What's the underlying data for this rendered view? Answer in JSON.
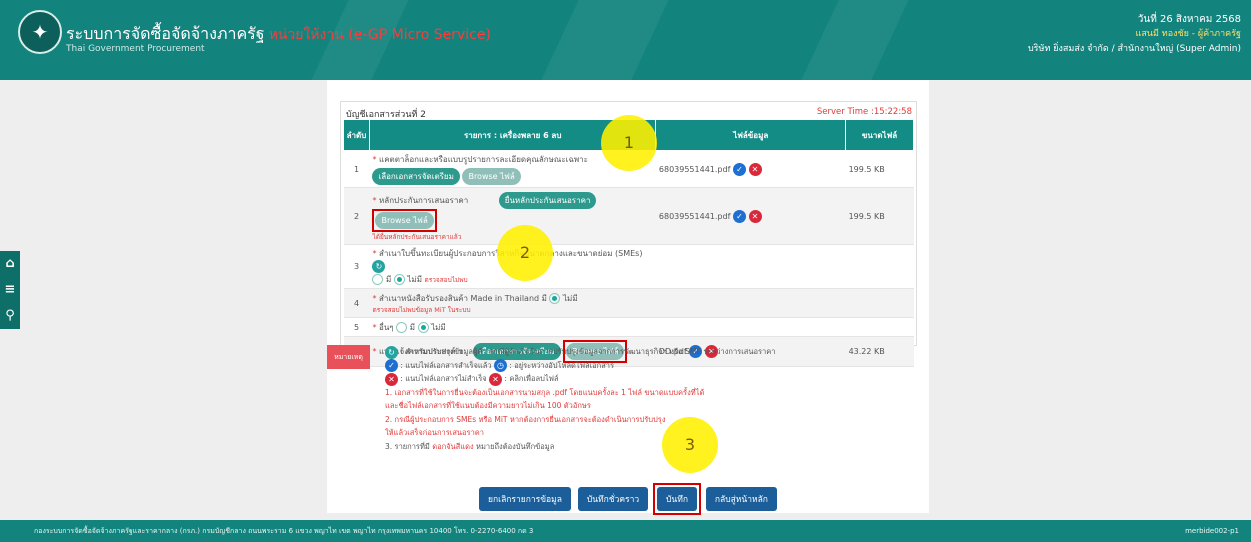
{
  "header": {
    "title": "ระบบการจัดซื้อจัดจ้างภาครัฐ",
    "subtitle": "หน่วยให้งาน (e-GP Micro Service)",
    "title_en": "Thai Government Procurement",
    "date": "วันที่ 26 สิงหาคม 2568",
    "user": "แสนมี ทองชัย - ผู้ค้าภาครัฐ",
    "org": "บริษัท ยิ่งสมส่ง จำกัด / สำนักงานใหญ่ (Super Admin)"
  },
  "sidebar": {
    "icons": [
      "home-icon",
      "menu-icon",
      "search-icon"
    ],
    "glyphs": [
      "⌂",
      "≡",
      "⚲"
    ]
  },
  "card": {
    "title": "บัญชีเอกสารส่วนที่ 2",
    "server_time": "Server Time :15:22:58",
    "columns": {
      "no": "ลำดับ",
      "item": "รายการ : เครื่องพลาย 6 ลบ",
      "file": "ไฟล์ข้อมูล",
      "size": "ขนาดไฟล์"
    },
    "rows": [
      {
        "no": "1",
        "label": "แคตตาล็อกและหรือแบบรูปรายการละเอียดคุณลักษณะเฉพาะ",
        "btn_select": "เลือกเอกสารจัดเตรียม",
        "btn_browse": "Browse ไฟล์",
        "file": "68039551441.pdf",
        "size": "199.5 KB"
      },
      {
        "no": "2",
        "label": "หลักประกันการเสนอราคา",
        "btn_guarantee": "ยื่นหลักประกันเสนอราคา",
        "btn_browse": "Browse ไฟล์",
        "note": "ได้ยื่นหลักประกันเสนอราคาแล้ว",
        "file": "68039551441.pdf",
        "size": "199.5 KB"
      },
      {
        "no": "3",
        "label": "สำเนาใบขึ้นทะเบียนผู้ประกอบการวิสาหกิจขนาดกลางและขนาดย่อม (SMEs)",
        "opt_yes": "มี",
        "opt_no": "ไม่มี",
        "note": "ตรวจสอบไม่พบ"
      },
      {
        "no": "4",
        "label": "สำเนาหนังสือรับรองสินค้า Made in Thailand",
        "opt_yes": "มี",
        "opt_no": "ไม่มี",
        "note": "ตรวจสอบไม่พบข้อมูล MiT ในระบบ"
      },
      {
        "no": "5",
        "label": "อื่นๆ",
        "opt_yes": "มี",
        "opt_no": "ไม่มี"
      },
      {
        "no": "6",
        "label": "แบบแจ้งความประสงค์ ฯ",
        "btn_select": "เลือกเอกสารจัดเตรียม",
        "btn_browse": "Browse ไฟล์",
        "file": "DD.pdf",
        "size": "43.22 KB"
      }
    ]
  },
  "legend": {
    "tab": "หมายเหตุ",
    "line1": ": สำหรับปรับปรุงข้อมูลผู้ค้า กรณีผู้ค้าดำเนินการปรับปรุงข้อมูลจากการพัฒนาธุรกิจฯ หรือ SME ระหว่างการเสนอราคา",
    "line2a": ": แนบไฟล์เอกสารสำเร็จแล้ว",
    "line2b": ": อยู่ระหว่างอัปโหลดไฟล์เอกสาร",
    "line3a": ": แนบไฟล์เอกสารไม่สำเร็จ",
    "line3b": ": คลิกเพื่อลบไฟล์",
    "note1a": "1. เอกสารที่ใช้ในการยื่นจะต้องเป็นเอกสารนามสกุล .pdf โดยแนบครั้งละ 1 ไฟล์ ขนาดแบบครั้งที่ได้",
    "note1b": "และชื่อไฟล์เอกสารที่ใช้แนบต้องมีความยาวไม่เกิน 100 ตัวอักษร",
    "note2a": "2. กรณีผู้ประกอบการ SMEs หรือ MiT หากต้องการยื่นเอกสารจะต้องดำเนินการปรับปรุง",
    "note2b": "ให้แล้วเสร็จก่อนการเสนอราคา",
    "note3": "3. รายการที่มี",
    "note3_red": "ดอกจันสีแดง",
    "note3_tail": "หมายถึงต้องบันทึกข้อมูล"
  },
  "actions": {
    "cancel": "ยกเลิกรายการข้อมูล",
    "draft": "บันทึกชั่วคราว",
    "save": "บันทึก",
    "back": "กลับสู่หน้าหลัก"
  },
  "markers": [
    "1",
    "2",
    "3"
  ],
  "footer": {
    "left": "กองระบบการจัดซื้อจัดจ้างภาครัฐและราคากลาง (กรภ.) กรมบัญชีกลาง ถนนพระราม 6 แขวง พญาไท เขต พญาไท กรุงเทพมหานคร 10400 โทร. 0-2270-6400 กด 3",
    "right": "merbide002-p1"
  },
  "colors": {
    "header": "#13837d",
    "table_header": "#138c86",
    "action_button": "#1b5e9a",
    "highlight_box": "#d40000",
    "marker": "#fff000"
  }
}
